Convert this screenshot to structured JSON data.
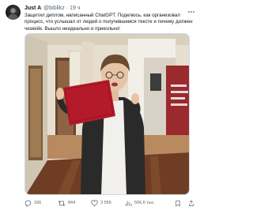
{
  "tweet": {
    "author_name": "Just A",
    "handle": "@biblikz",
    "separator": "·",
    "time": "19 ч",
    "text_lines": [
      "Защитил диплом, написанный ChatGPT. Поделюсь, как организовал",
      "процесс, что услышал от людей о получившемся тексте и почему должен",
      "чизкейк. Вышло неидеально и прикольно!"
    ],
    "more_icon": "more-dots-icon",
    "photo": {
      "description_visible": false,
      "colors": {
        "wall": "#e9e2d3",
        "coat": "#2a2a2a",
        "diploma": "#b51a2a",
        "floor": "#6b3a22"
      }
    }
  },
  "actions": {
    "reply": {
      "icon": "reply-icon",
      "count": "166"
    },
    "retweet": {
      "icon": "retweet-icon",
      "count": "844"
    },
    "like": {
      "icon": "heart-icon",
      "count": "3 556"
    },
    "views": {
      "icon": "views-chart-icon",
      "count": "506,6 тыс."
    },
    "bookmark": {
      "icon": "bookmark-icon"
    },
    "share": {
      "icon": "share-icon"
    }
  }
}
